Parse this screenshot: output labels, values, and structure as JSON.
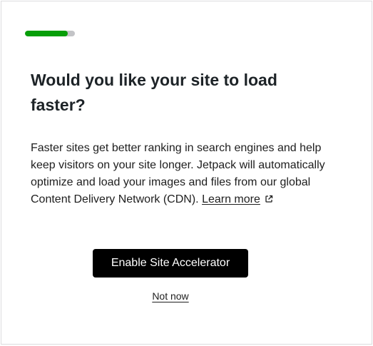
{
  "progress": {
    "fraction": 0.85,
    "track_color": "#c3c4c7",
    "fill_color": "#069e08"
  },
  "dialog": {
    "title": "Would you like your site to load faster?",
    "description": "Faster sites get better ranking in search engines and help keep visitors on your site longer. Jetpack will automatically optimize and load your images and files from our global Content Delivery Network (CDN).",
    "learn_more_label": "Learn more",
    "learn_more_icon": "external-link-icon",
    "primary_button_label": "Enable Site Accelerator",
    "secondary_button_label": "Not now"
  },
  "colors": {
    "primary_button_bg": "#000000",
    "primary_button_text": "#ffffff"
  }
}
